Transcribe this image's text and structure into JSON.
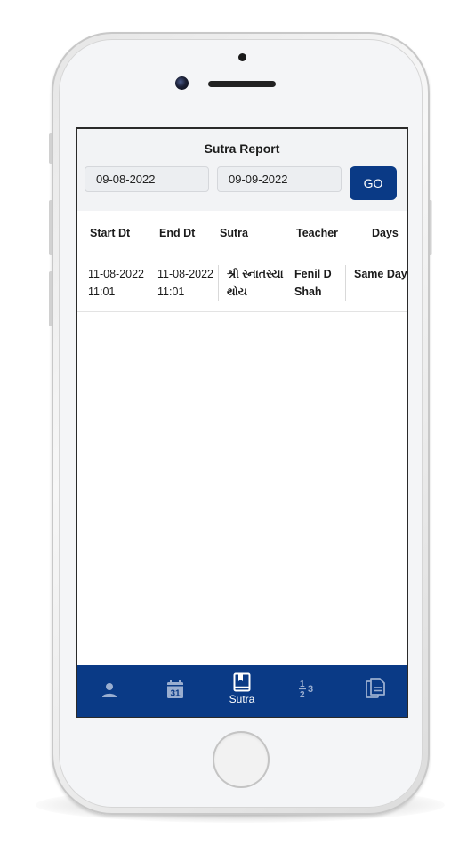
{
  "header": {
    "title": "Sutra Report"
  },
  "filters": {
    "start_date": "09-08-2022",
    "end_date": "09-09-2022",
    "go_label": "GO"
  },
  "table": {
    "columns": [
      "Start Dt",
      "End Dt",
      "Sutra",
      "Teacher",
      "Days"
    ],
    "rows": [
      {
        "start_date": "11-08-2022",
        "start_time": "11:01",
        "end_date": "11-08-2022",
        "end_time": "11:01",
        "sutra_line1": "શ્રી સ્નાતસ્યા",
        "sutra_line2": "થોય",
        "teacher_line1": "Fenil D",
        "teacher_line2": "Shah",
        "days": "Same Day"
      }
    ]
  },
  "bottom_nav": {
    "items": [
      {
        "icon": "person-icon",
        "label": ""
      },
      {
        "icon": "calendar-icon",
        "label": "",
        "badge": "31"
      },
      {
        "icon": "book-icon",
        "label": "Sutra",
        "active": true
      },
      {
        "icon": "numbers-icon",
        "label": ""
      },
      {
        "icon": "document-icon",
        "label": ""
      }
    ]
  },
  "colors": {
    "primary": "#0a3a86",
    "header_bg": "#f2f3f5",
    "inactive_icon": "#9aaed0"
  }
}
